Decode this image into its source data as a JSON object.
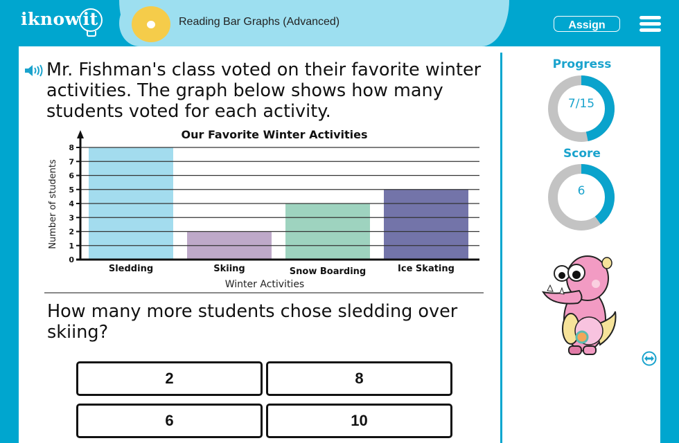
{
  "header": {
    "logo_text": "iknow",
    "logo_bulb_text": "it",
    "lesson_title": "Reading Bar Graphs (Advanced)",
    "assign_label": "Assign",
    "menu_icon": "hamburger-menu-icon",
    "colors": {
      "frame": "#00a6cf",
      "pill": "#9ddff0",
      "lesson_icon": "#f5cc4a"
    }
  },
  "prompt": {
    "sound_icon": "speaker-icon",
    "text": "Mr. Fishman's class voted on their favorite winter activities. The graph below shows how many students voted for each activity."
  },
  "chart_data": {
    "type": "bar",
    "title": "Our Favorite Winter Activities",
    "xlabel": "Winter Activities",
    "ylabel": "Number of students",
    "categories": [
      "Sledding",
      "Skiing",
      "Snow Boarding",
      "Ice Skating"
    ],
    "values": [
      8,
      2,
      4,
      5
    ],
    "colors": [
      "#a3dcee",
      "#bea9c9",
      "#9ed3bf",
      "#7374a9"
    ],
    "ylim": [
      0,
      8
    ],
    "yticks": [
      0,
      1,
      2,
      3,
      4,
      5,
      6,
      7,
      8
    ],
    "grid": true
  },
  "question": {
    "text": "How many more students chose sledding over skiing?",
    "answers": [
      "2",
      "8",
      "6",
      "10"
    ]
  },
  "sidebar": {
    "progress": {
      "label": "Progress",
      "text": "7/15",
      "current": 7,
      "total": 15
    },
    "score": {
      "label": "Score",
      "text": "6",
      "fraction": 0.4
    },
    "mascot": "pink-monster-mascot",
    "expand_icon": "expand-arrows-icon"
  }
}
